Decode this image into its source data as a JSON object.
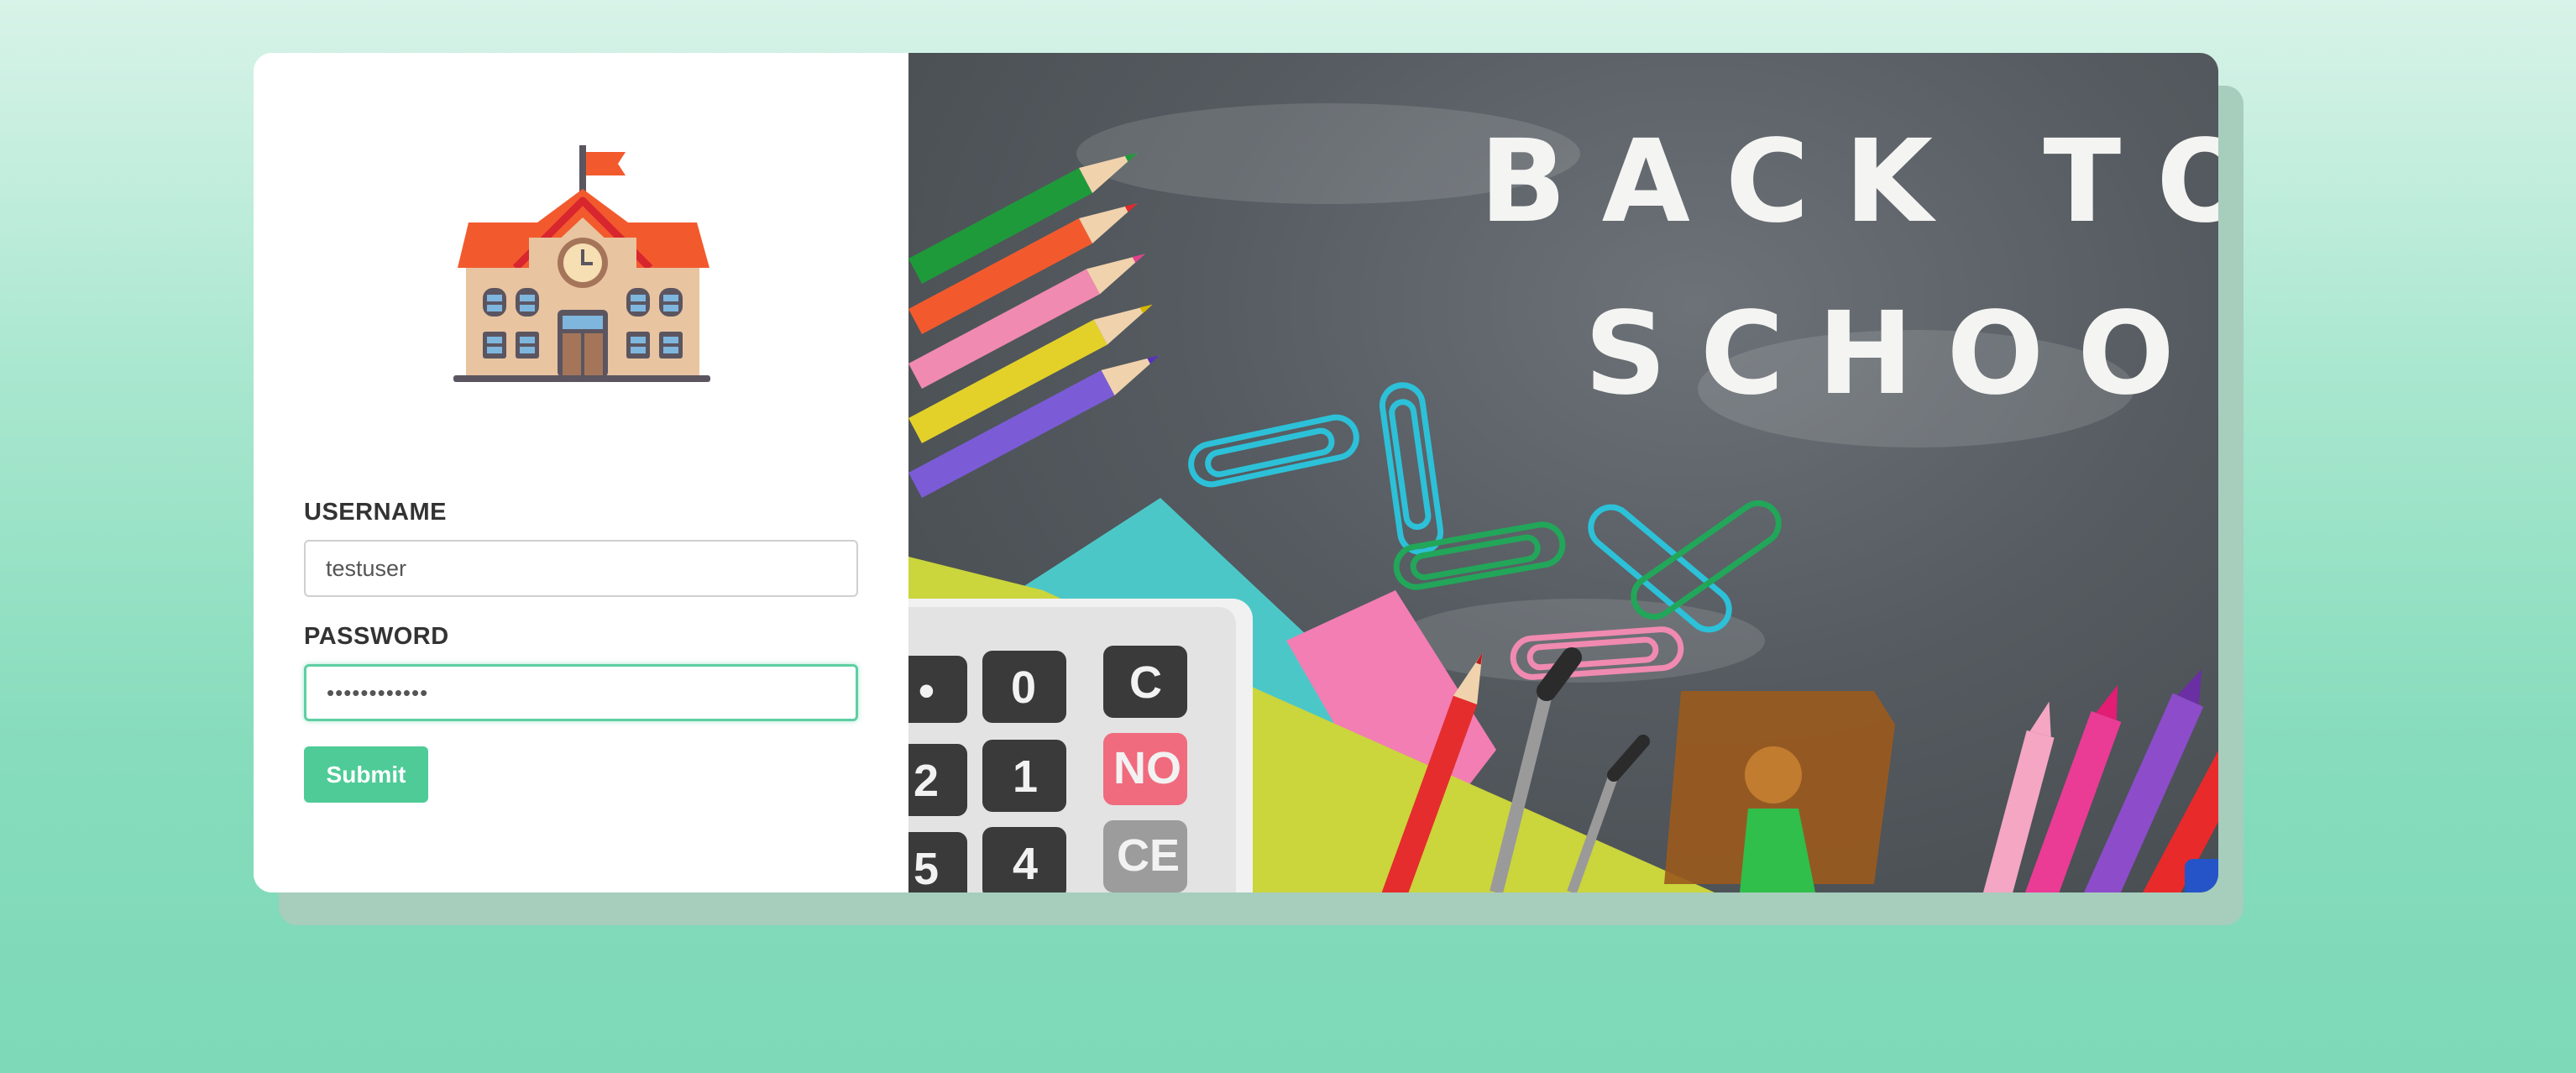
{
  "form": {
    "username_label": "USERNAME",
    "username_value": "testuser",
    "password_label": "PASSWORD",
    "password_value": "••••••••••••",
    "submit_label": "Submit"
  },
  "logo": {
    "icon": "school-building-icon"
  },
  "hero": {
    "line1": "BACK TO",
    "line2": "SCHOOL",
    "calculator_keys": [
      "•",
      "0",
      "C",
      "2",
      "1",
      "NO",
      "5",
      "4",
      "CE"
    ]
  },
  "colors": {
    "accent": "#4ecb97",
    "focus_border": "#5fcfa3",
    "background": "#86dcbc"
  }
}
